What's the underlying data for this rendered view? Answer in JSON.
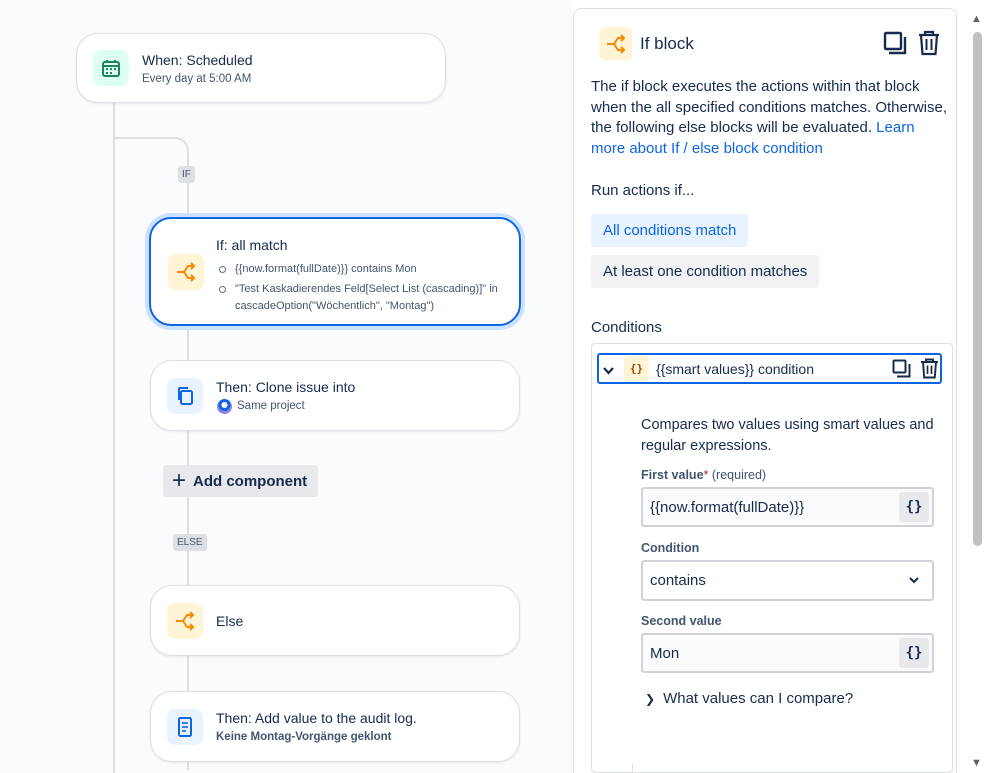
{
  "flow": {
    "trigger": {
      "title": "When: Scheduled",
      "subtitle": "Every day at 5:00 AM",
      "icon": "calendar-icon"
    },
    "if_label": "IF",
    "if_block": {
      "title": "If: all match",
      "conditions": [
        "{{now.format(fullDate)}} contains Mon",
        "\"Test Kaskadierendes Feld[Select List (cascading)]\" in cascadeOption(\"Wöchentlich\", \"Montag\")"
      ],
      "icon": "branch-icon"
    },
    "clone_action": {
      "title": "Then: Clone issue into",
      "subtitle": "Same project",
      "icon": "copy-icon"
    },
    "add_component": {
      "label": "Add component"
    },
    "else_label": "ELSE",
    "else_block": {
      "title": "Else",
      "icon": "branch-icon"
    },
    "audit_action": {
      "title": "Then: Add value to the audit log.",
      "subtitle": "Keine Montag-Vorgänge geklont",
      "icon": "document-icon"
    }
  },
  "panel": {
    "title": "If block",
    "description": "The if block executes the actions within that block when the all specified conditions matches. Otherwise, the following else blocks will be evaluated.",
    "learn_more": "Learn more about If / else block condition",
    "run_actions_label": "Run actions if...",
    "options": {
      "all": "All conditions match",
      "any": "At least one condition matches",
      "selected": "All conditions match"
    },
    "conditions_heading": "Conditions",
    "condition": {
      "icon_text": "{}",
      "title": "{{smart values}} condition",
      "description": "Compares two values using smart values and regular expressions.",
      "first_value_label": "First value",
      "required_mark": "*",
      "required_text": "(required)",
      "first_value": "{{now.format(fullDate)}}",
      "condition_label": "Condition",
      "condition_value": "contains",
      "second_value_label": "Second value",
      "second_value": "Mon",
      "smart_value_button": "{}",
      "help_expander": "What values can I compare?"
    }
  },
  "colors": {
    "accent": "#0c66e4",
    "orange_icon": "#f38a00",
    "green_icon": "#1f845a"
  }
}
